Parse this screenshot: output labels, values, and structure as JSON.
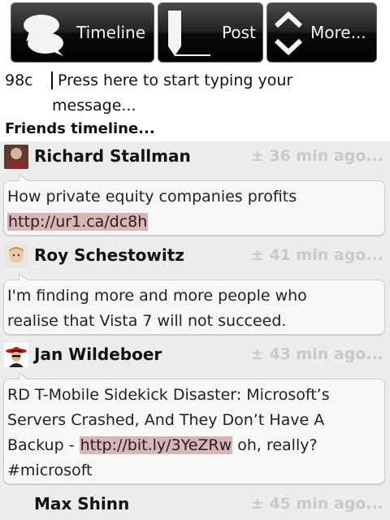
{
  "toolbar": {
    "timeline_label": "Timeline",
    "post_label": "Post",
    "more_label": "More..."
  },
  "compose": {
    "char_count": "98c",
    "placeholder_line1": "Press here to start typing your",
    "placeholder_line2": "message..."
  },
  "timeline_title": "Friends timeline...",
  "entries": [
    {
      "author": "Richard Stallman",
      "time": "± 36 min ago...",
      "text_before": "How private equity companies profits",
      "link": "http://ur1.ca/dc8h",
      "text_after": ""
    },
    {
      "author": "Roy Schestowitz",
      "time": "± 41 min ago...",
      "line1": "I'm finding more and more people who",
      "line2": "realise that Vista 7 will not succeed."
    },
    {
      "author": "Jan Wildeboer",
      "time": "± 43 min ago...",
      "line1": "RD T-Mobile Sidekick Disaster: Microsoft’s",
      "line2": "Servers Crashed, And They Don’t Have A",
      "line3_before": "Backup - ",
      "link": "http://bit.ly/3YeZRw",
      "line3_after": " oh, really?",
      "line4": "#microsoft"
    },
    {
      "author": "Max Shinn",
      "time": "± 45 min ago..."
    }
  ],
  "colors": {
    "link_highlight": "#d9b5b8",
    "timestamp": "#c9c9c9",
    "toolbar": "#1a1a1a",
    "timeline_bg": "#ececec"
  }
}
